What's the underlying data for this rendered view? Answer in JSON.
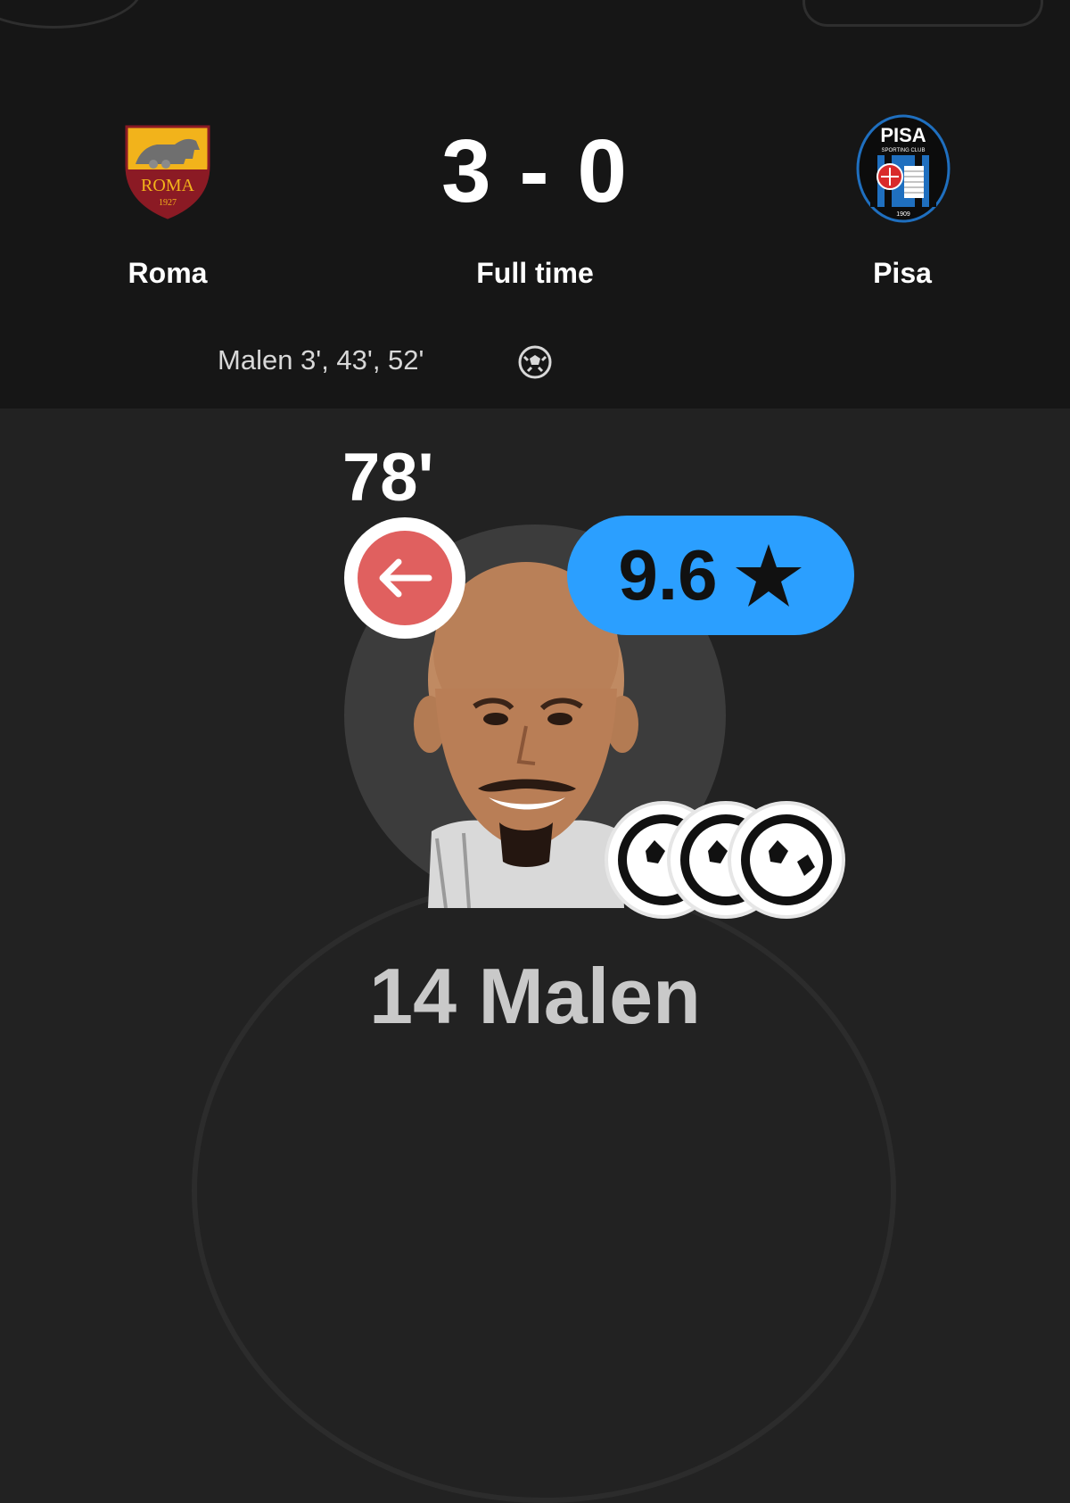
{
  "match": {
    "home_team": "Roma",
    "away_team": "Pisa",
    "score": "3 - 0",
    "status": "Full time",
    "home_scorers": "Malen 3', 43', 52'",
    "home_crest": {
      "club": "ROMA",
      "year": "1927"
    },
    "away_crest": {
      "club": "PISA",
      "subtitle": "SPORTING CLUB",
      "year": "1909"
    }
  },
  "player": {
    "sub_minute": "78'",
    "rating": "9.6",
    "goals": 3,
    "name": "14 Malen"
  },
  "colors": {
    "header_bg": "#161616",
    "body_bg": "#222222",
    "rating_badge": "#2b9fff",
    "sub_off": "#e0605f",
    "roma_red": "#8b1a24",
    "roma_gold": "#f2b31b",
    "pisa_blue": "#1f6fbf"
  },
  "icons": [
    "ball-icon",
    "arrow-left-icon",
    "star-icon"
  ]
}
